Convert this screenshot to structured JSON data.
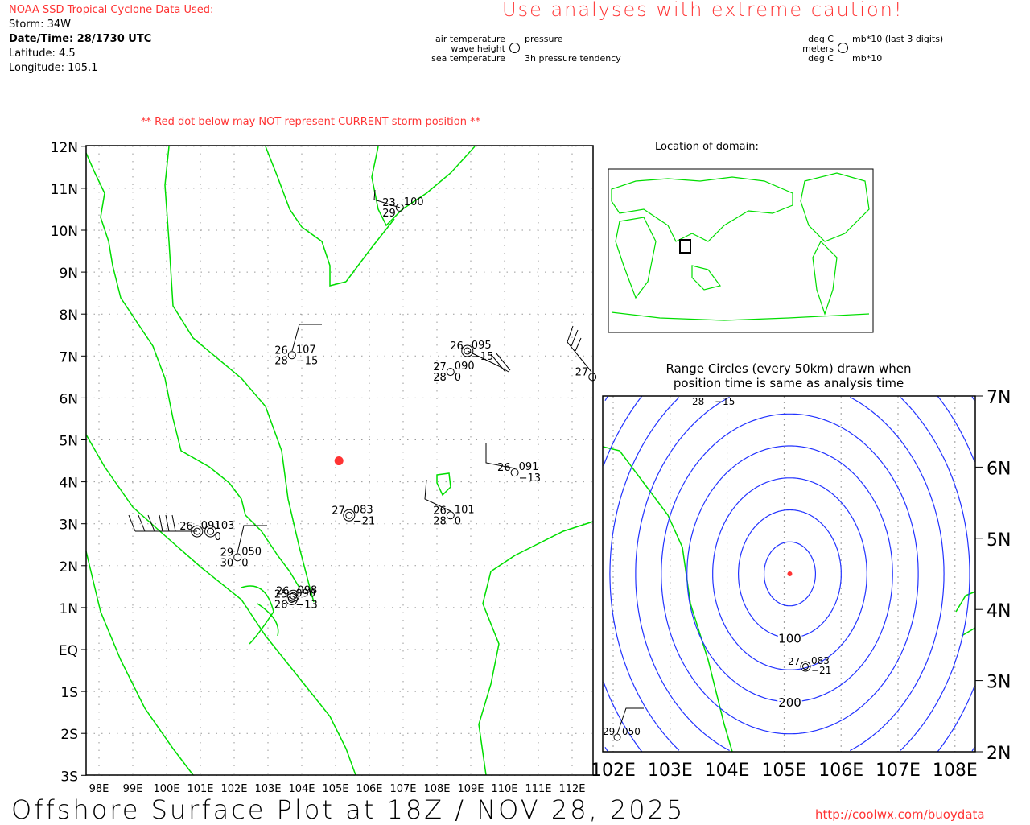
{
  "header": {
    "source_title": "NOAA SSD Tropical Cyclone Data Used:",
    "storm": "Storm: 34W",
    "datetime": "Date/Time: 28/1730 UTC",
    "latitude": "Latitude: 4.5",
    "longitude": "Longitude: 105.1",
    "caution": "Use analyses with extreme caution!"
  },
  "legend": {
    "left_labels": [
      "air temperature",
      "wave height",
      "sea temperature"
    ],
    "right_labels": [
      "pressure",
      "3h pressure tendency"
    ],
    "left_units": [
      "deg C",
      "meters",
      "deg C"
    ],
    "right_units": [
      "mb*10 (last 3 digits)",
      "mb*10"
    ]
  },
  "main_map": {
    "warning": "** Red dot below may NOT represent CURRENT storm position **",
    "lon_ticks": [
      "98E",
      "99E",
      "100E",
      "101E",
      "102E",
      "103E",
      "104E",
      "105E",
      "106E",
      "107E",
      "108E",
      "109E",
      "110E",
      "111E",
      "112E"
    ],
    "lat_ticks": [
      "12N",
      "11N",
      "10N",
      "9N",
      "8N",
      "7N",
      "6N",
      "5N",
      "4N",
      "3N",
      "2N",
      "1N",
      "EQ",
      "1S",
      "2S",
      "3S"
    ],
    "storm_position": {
      "lat": 4.5,
      "lon": 105.1
    },
    "storm_color": "#ff3333",
    "coast_color": "#00dd00"
  },
  "stations": [
    {
      "lon": 103.71,
      "lat": 7.02,
      "air": "26",
      "pres": "107",
      "sea": "28",
      "tend": "−15",
      "double": false
    },
    {
      "lon": 108.9,
      "lat": 7.12,
      "air": "26",
      "pres": "095",
      "sea": "",
      "tend": "−15",
      "double": true
    },
    {
      "lon": 108.4,
      "lat": 6.62,
      "air": "27",
      "pres": "090",
      "sea": "28",
      "tend": "0",
      "double": false
    },
    {
      "lon": 110.3,
      "lat": 4.22,
      "air": "26",
      "pres": "091",
      "sea": "",
      "tend": "−13",
      "double": false
    },
    {
      "lon": 108.4,
      "lat": 3.2,
      "air": "26",
      "pres": "101",
      "sea": "28",
      "tend": "0",
      "double": false
    },
    {
      "lon": 105.4,
      "lat": 3.2,
      "air": "27",
      "pres": "083",
      "sea": "",
      "tend": "−21",
      "double": true
    },
    {
      "lon": 102.1,
      "lat": 2.2,
      "air": "29",
      "pres": "050",
      "sea": "30",
      "tend": "0",
      "double": false
    },
    {
      "lon": 100.9,
      "lat": 2.82,
      "air": "26",
      "pres": "091",
      "sea": "",
      "tend": "",
      "double": true
    },
    {
      "lon": 101.3,
      "lat": 2.82,
      "air": "",
      "pres": "103",
      "sea": "",
      "tend": "0",
      "double": true
    },
    {
      "lon": 106.9,
      "lat": 10.54,
      "air": "23",
      "pres": "100",
      "sea": "29",
      "tend": "",
      "double": false
    },
    {
      "lon": 112.6,
      "lat": 6.5,
      "air": "27",
      "pres": "",
      "sea": "",
      "tend": "",
      "double": false
    },
    {
      "lon": 103.7,
      "lat": 1.2,
      "air": "25",
      "pres": "090",
      "sea": "26",
      "tend": "−13",
      "double": true
    },
    {
      "lon": 103.75,
      "lat": 1.28,
      "air": "26",
      "pres": "098",
      "sea": "",
      "tend": "",
      "double": true
    }
  ],
  "locator": {
    "title": "Location of domain:"
  },
  "inset": {
    "title_line1": "Range Circles (every 50km) drawn when",
    "title_line2": "position time is same as analysis time",
    "lon_ticks": [
      "102E",
      "103E",
      "104E",
      "105E",
      "106E",
      "107E",
      "108E"
    ],
    "lat_ticks": [
      "7N",
      "6N",
      "5N",
      "4N",
      "3N",
      "2N"
    ],
    "ring_spacing_km": 50,
    "ring_labels": [
      "100",
      "200"
    ],
    "ring_color": "#2233ff"
  },
  "footer": {
    "title": "Offshore Surface Plot at 18Z / NOV 28, 2025",
    "url": "http://coolwx.com/buoydata"
  }
}
